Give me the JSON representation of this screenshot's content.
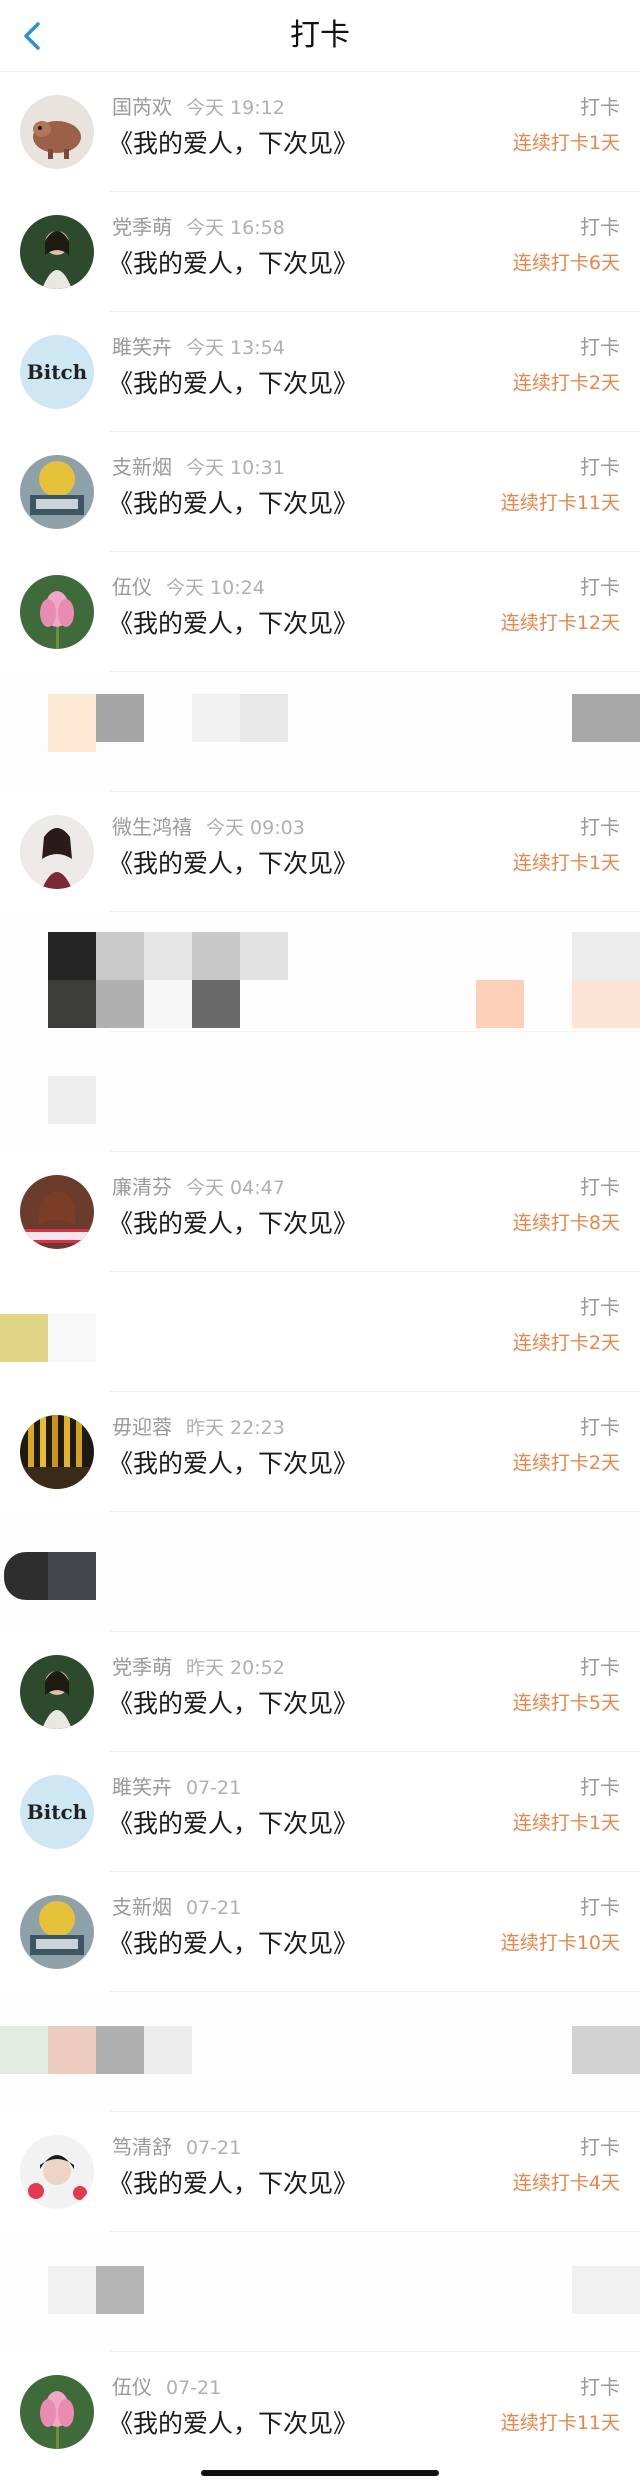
{
  "nav": {
    "title": "打卡",
    "back_icon": "chevron-left-icon"
  },
  "colors": {
    "accent": "#2f8fd6",
    "streak": "#e8864a",
    "meta": "#9a9a9a"
  },
  "rows": [
    {
      "name": "国芮欢",
      "time": "今天 19:12",
      "content": "《我的爱人，下次见》",
      "action": "打卡",
      "streak": "连续打卡1天"
    },
    {
      "name": "党季萌",
      "time": "今天 16:58",
      "content": "《我的爱人，下次见》",
      "action": "打卡",
      "streak": "连续打卡6天"
    },
    {
      "name": "雎笑卉",
      "time": "今天 13:54",
      "content": "《我的爱人，下次见》",
      "action": "打卡",
      "streak": "连续打卡2天",
      "avatar_text": "Bitch"
    },
    {
      "name": "支新烟",
      "time": "今天 10:31",
      "content": "《我的爱人，下次见》",
      "action": "打卡",
      "streak": "连续打卡11天"
    },
    {
      "name": "伍仪",
      "time": "今天 10:24",
      "content": "《我的爱人，下次见》",
      "action": "打卡",
      "streak": "连续打卡12天"
    },
    {
      "name": "微生鸿禧",
      "time": "今天 09:03",
      "content": "《我的爱人，下次见》",
      "action": "打卡",
      "streak": "连续打卡1天"
    },
    {
      "name": "廉清芬",
      "time": "今天 04:47",
      "content": "《我的爱人，下次见》",
      "action": "打卡",
      "streak": "连续打卡8天"
    },
    {
      "name": "",
      "time": "",
      "content": "",
      "action": "打卡",
      "streak": "连续打卡2天"
    },
    {
      "name": "毋迎蓉",
      "time": "昨天 22:23",
      "content": "《我的爱人，下次见》",
      "action": "打卡",
      "streak": "连续打卡2天"
    },
    {
      "name": "党季萌",
      "time": "昨天 20:52",
      "content": "《我的爱人，下次见》",
      "action": "打卡",
      "streak": "连续打卡5天"
    },
    {
      "name": "雎笑卉",
      "time": "07-21",
      "content": "《我的爱人，下次见》",
      "action": "打卡",
      "streak": "连续打卡1天",
      "avatar_text": "Bitch"
    },
    {
      "name": "支新烟",
      "time": "07-21",
      "content": "《我的爱人，下次见》",
      "action": "打卡",
      "streak": "连续打卡10天"
    },
    {
      "name": "笃清舒",
      "time": "07-21",
      "content": "《我的爱人，下次见》",
      "action": "打卡",
      "streak": "连续打卡4天"
    },
    {
      "name": "伍仪",
      "time": "07-21",
      "content": "《我的爱人，下次见》",
      "action": "打卡",
      "streak": "连续打卡11天"
    }
  ]
}
